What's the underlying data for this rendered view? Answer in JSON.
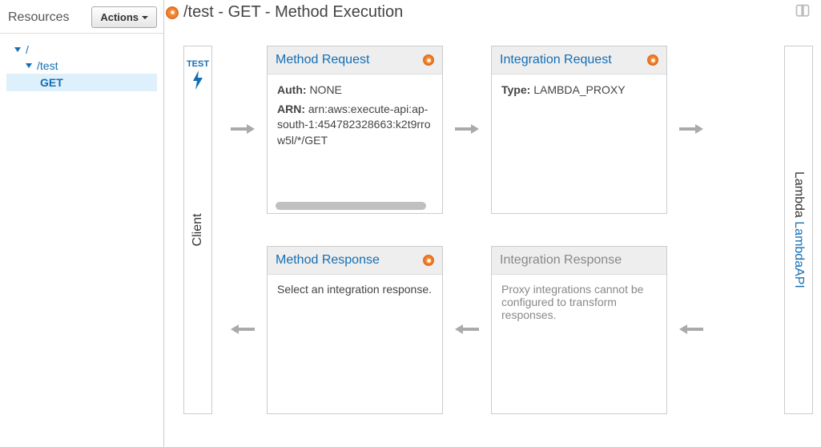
{
  "sidebar": {
    "title": "Resources",
    "actions_label": "Actions",
    "tree": {
      "root": "/",
      "child": "/test",
      "method": "GET"
    }
  },
  "header": {
    "title": "/test - GET - Method Execution"
  },
  "client": {
    "test_label": "TEST",
    "label": "Client"
  },
  "lambda": {
    "prefix": "Lambda ",
    "api_name": "LambdaAPI"
  },
  "cards": {
    "method_request": {
      "title": "Method Request",
      "auth_label": "Auth:",
      "auth_value": "NONE",
      "arn_label": "ARN:",
      "arn_value": "arn:aws:execute-api:ap-south-1:454782328663:k2t9rrow5l/*/GET"
    },
    "integration_request": {
      "title": "Integration Request",
      "type_label": "Type:",
      "type_value": "LAMBDA_PROXY"
    },
    "method_response": {
      "title": "Method Response",
      "body": "Select an integration response."
    },
    "integration_response": {
      "title": "Integration Response",
      "body": "Proxy integrations cannot be configured to transform responses."
    }
  }
}
